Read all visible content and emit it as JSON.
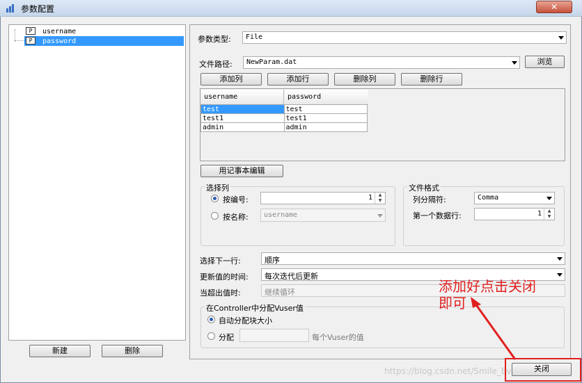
{
  "window": {
    "title": "参数配置",
    "close_label": "✕"
  },
  "tree": {
    "items": [
      {
        "label": "username",
        "icon": "P"
      },
      {
        "label": "password",
        "icon": "P"
      }
    ]
  },
  "left_buttons": {
    "new": "新建",
    "delete": "删除"
  },
  "param_type": {
    "label": "参数类型:",
    "value": "File"
  },
  "file_path": {
    "label": "文件路径:",
    "value": "NewParam.dat",
    "browse": "浏览"
  },
  "toolbar": {
    "add_column": "添加列",
    "add_row": "添加行",
    "delete_column": "删除列",
    "delete_row": "删除行"
  },
  "table": {
    "headers": [
      "username",
      "password"
    ],
    "rows": [
      [
        "test",
        "test"
      ],
      [
        "test1",
        "test1"
      ],
      [
        "admin",
        "admin"
      ]
    ]
  },
  "notepad_button": "用记事本编辑",
  "select_column": {
    "title": "选择列",
    "by_number_label": "按编号:",
    "by_number_value": "1",
    "by_name_label": "按名称:",
    "by_name_value": "username"
  },
  "file_format": {
    "title": "文件格式",
    "delimiter_label": "列分隔符:",
    "delimiter_value": "Comma",
    "first_row_label": "第一个数据行:",
    "first_row_value": "1"
  },
  "next_row": {
    "label": "选择下一行:",
    "value": "顺序"
  },
  "update_value": {
    "label": "更新值的时间:",
    "value": "每次迭代后更新"
  },
  "out_of_values": {
    "label": "当超出值时:",
    "value": "继续循环"
  },
  "allocate": {
    "title": "在Controller中分配Vuser值",
    "auto_label": "自动分配块大小",
    "manual_label": "分配",
    "manual_suffix": "每个Vuser的值"
  },
  "annotation": {
    "text_line1": "添加好点击关闭",
    "text_line2": "即可",
    "color": "#e02020"
  },
  "footer": {
    "close": "关闭",
    "watermark": "https://blog.csdn.net/Smile_Everyday"
  }
}
